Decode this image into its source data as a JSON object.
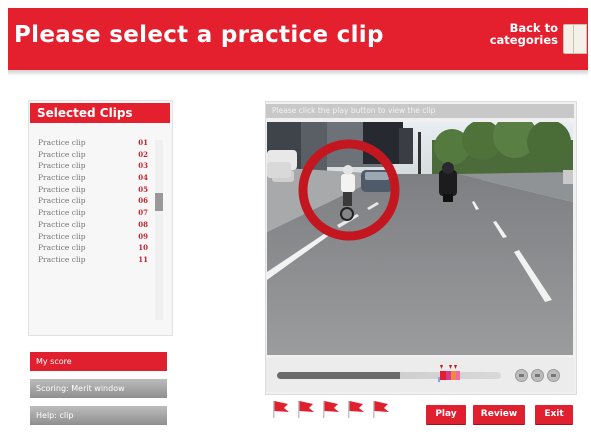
{
  "header": {
    "title": "Please select a practice clip",
    "back_line1": "Back to",
    "back_line2": "categories"
  },
  "clips_panel": {
    "title": "Selected Clips",
    "items": [
      {
        "label": "Practice clip",
        "num": "01"
      },
      {
        "label": "Practice clip",
        "num": "02"
      },
      {
        "label": "Practice clip",
        "num": "03"
      },
      {
        "label": "Practice clip",
        "num": "04"
      },
      {
        "label": "Practice clip",
        "num": "05"
      },
      {
        "label": "Practice clip",
        "num": "06"
      },
      {
        "label": "Practice clip",
        "num": "07"
      },
      {
        "label": "Practice clip",
        "num": "08"
      },
      {
        "label": "Practice clip",
        "num": "09"
      },
      {
        "label": "Practice clip",
        "num": "10"
      },
      {
        "label": "Practice clip",
        "num": "11"
      }
    ]
  },
  "left_buttons": {
    "my_score": "My score",
    "scoring": "Scoring: Merit window",
    "help": "Help: clip"
  },
  "video": {
    "caption": "Please click the play button to view the clip",
    "playback_progress": 0.55
  },
  "actions": {
    "play": "Play",
    "review": "Review",
    "exit": "Exit"
  },
  "colors": {
    "brand_red": "#e41f2e",
    "panel_grey": "#f0f0f0",
    "hazard_circle": "#c4161f",
    "flag_red": "#e0202e"
  },
  "icons": {
    "book": "book-icon",
    "flag": "flag-icon",
    "prev": "rewind-icon",
    "pause": "pause-icon",
    "next": "forward-icon"
  }
}
